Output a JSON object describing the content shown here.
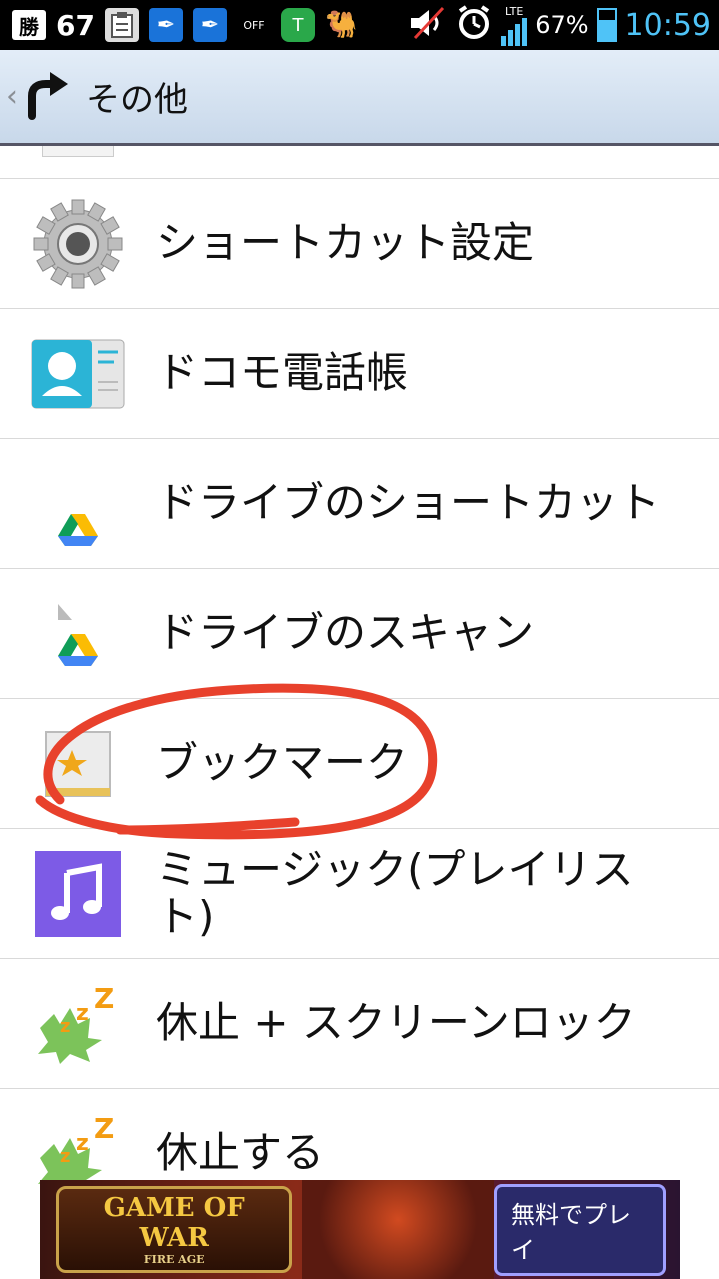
{
  "status_bar": {
    "kachi": "勝",
    "notification_count": "67",
    "off_label": "OFF",
    "network": "LTE",
    "battery": "67%",
    "battery_level": 0.67,
    "time": "10:59"
  },
  "header": {
    "title": "その他"
  },
  "list": {
    "items": [
      {
        "label": "ショートカット設定",
        "icon": "gear-icon"
      },
      {
        "label": "ドコモ電話帳",
        "icon": "contact-card-icon"
      },
      {
        "label": "ドライブのショートカット",
        "icon": "drive-icon"
      },
      {
        "label": "ドライブのスキャン",
        "icon": "drive-scan-icon"
      },
      {
        "label": "ブックマーク",
        "icon": "bookmark-star-icon"
      },
      {
        "label": "ミュージック(プレイリスト)",
        "icon": "music-note-icon"
      },
      {
        "label": "休止 + スクリーンロック",
        "icon": "sleep-leaf-icon"
      },
      {
        "label": "休止する",
        "icon": "sleep-leaf-icon"
      }
    ]
  },
  "ad": {
    "logo_main": "GAME OF WAR",
    "logo_sub": "FIRE AGE",
    "button": "無料でプレイ"
  },
  "colors": {
    "annotation": "#e8412c",
    "time_accent": "#4fc3f7"
  }
}
